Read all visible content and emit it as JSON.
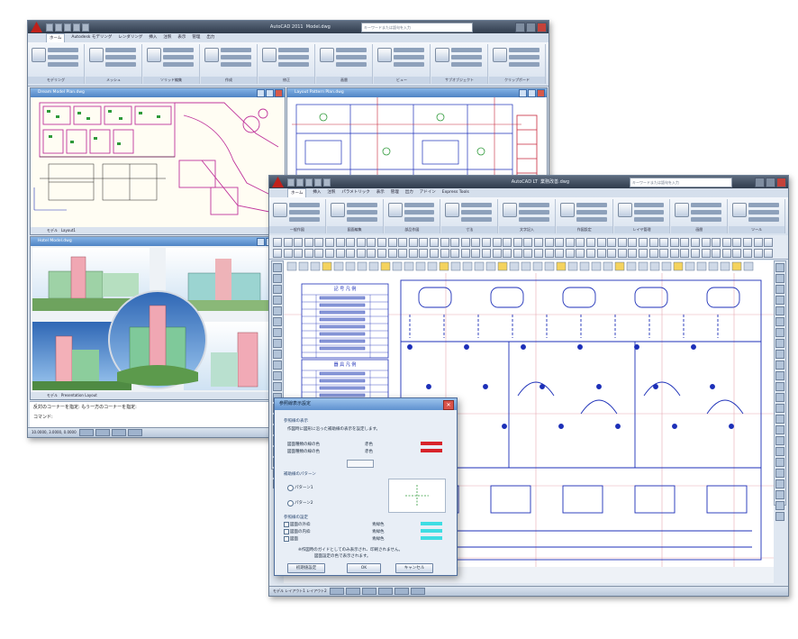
{
  "back_window": {
    "app_title": "AutoCAD 2011",
    "file_title": "Model.dwg",
    "search_placeholder": "キーワードまたは語句を入力",
    "menu_tabs": [
      "ホーム",
      "Autodesk モデリング",
      "レンダリング",
      "挿入",
      "注釈",
      "表示",
      "管理",
      "出力"
    ],
    "ribbon_groups": [
      "モデリング",
      "メッシュ",
      "ソリッド編集",
      "作成",
      "修正",
      "画層",
      "ビュー",
      "サブオブジェクト",
      "クリップボード"
    ],
    "layer_combo": "0",
    "subwindow_1_title": "Dream Model Plan.dwg",
    "subwindow_2_title": "Layout Pattern Plan.dwg",
    "subwindow_3_title": "Hotel Model.dwg",
    "nav_tabs_1": [
      "モデル",
      "Layout1"
    ],
    "nav_tabs_3": [
      "モデル",
      "Presentation Layout"
    ],
    "command_line_1": "反対のコーナーを指定: もう一方のコーナーを指定:",
    "command_line_2": "コマンド:",
    "coords": "10.0000, 3.0000, 0.0000"
  },
  "front_window": {
    "app_title": "AutoCAD LT",
    "file_title": "業務改善.dwg",
    "search_placeholder": "キーワードまたは語句を入力",
    "menu_tabs": [
      "ホーム",
      "挿入",
      "注釈",
      "パラメトリック",
      "表示",
      "管理",
      "出力",
      "アドイン",
      "Express Tools"
    ],
    "ribbon_groups": [
      "一般作図",
      "図面編集",
      "部品作図",
      "寸法",
      "文字記入",
      "作図設定",
      "レイヤ管理",
      "画層",
      "ツール"
    ],
    "status_text": "モデル  レイアウト1  レイアウト2"
  },
  "legend_table": {
    "title_1": "記 号 凡 例",
    "title_2": "器 具 凡 例"
  },
  "dialog": {
    "title": "参照線表示設定",
    "section_1": "参照線の表示",
    "desc_1": "作図時に図形に沿った補助線の表示を設定します。",
    "row_1_label": "図面種類の線の色",
    "row_1_value": "赤色",
    "row_2_label": "図面種類の線の色",
    "row_2_value": "赤色",
    "section_2": "補助線のパターン",
    "radio_1": "パターン1",
    "radio_2": "パターン2",
    "section_3": "参照線の設定",
    "check_1": "図面の外枠",
    "check_1_value": "青緑色",
    "check_2": "図面の内枠",
    "check_2_value": "青緑色",
    "check_3": "図面",
    "check_3_value": "青緑色",
    "note": "※作図時のガイドとしてのみ表示され、印刷されません。",
    "note_2": "図面設定の色で表示されます。",
    "btn_default": "初期値設定",
    "btn_ok": "OK",
    "btn_cancel": "キャンセル",
    "colors": {
      "red": "#d8232a",
      "cyan": "#3fdde3"
    }
  },
  "colors": {
    "plan_magenta": "#c0359c",
    "plan_green": "#2f9a3a",
    "plan_blue": "#1c2fb8",
    "plan_red": "#c8283c",
    "sky": "#5fa8e8"
  }
}
